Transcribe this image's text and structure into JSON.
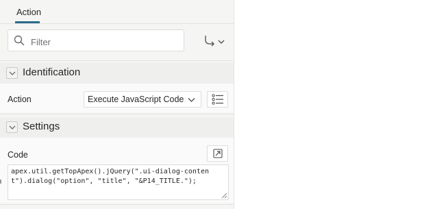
{
  "tabs": [
    {
      "label": "Action",
      "selected": true
    }
  ],
  "filter": {
    "placeholder": "Filter",
    "value": ""
  },
  "icons": {
    "search": "search-icon",
    "goto_group": "arrow-down-right-icon",
    "chevron": "chevron-down-icon",
    "list": "numbered-list-icon",
    "expand": "expand-arrow-icon"
  },
  "sections": {
    "identification": {
      "title": "Identification",
      "action_label": "Action",
      "action_value": "Execute JavaScript Code"
    },
    "settings": {
      "title": "Settings",
      "code_label": "Code",
      "code_value": "apex.util.getTopApex().jQuery(\".ui-dialog-content\").dialog(\"option\", \"title\", \"&P14_TITLE.\");"
    }
  },
  "colors": {
    "accent": "#2b6b8a",
    "panel_background": "#f5f5f4",
    "section_header": "#efefee"
  }
}
